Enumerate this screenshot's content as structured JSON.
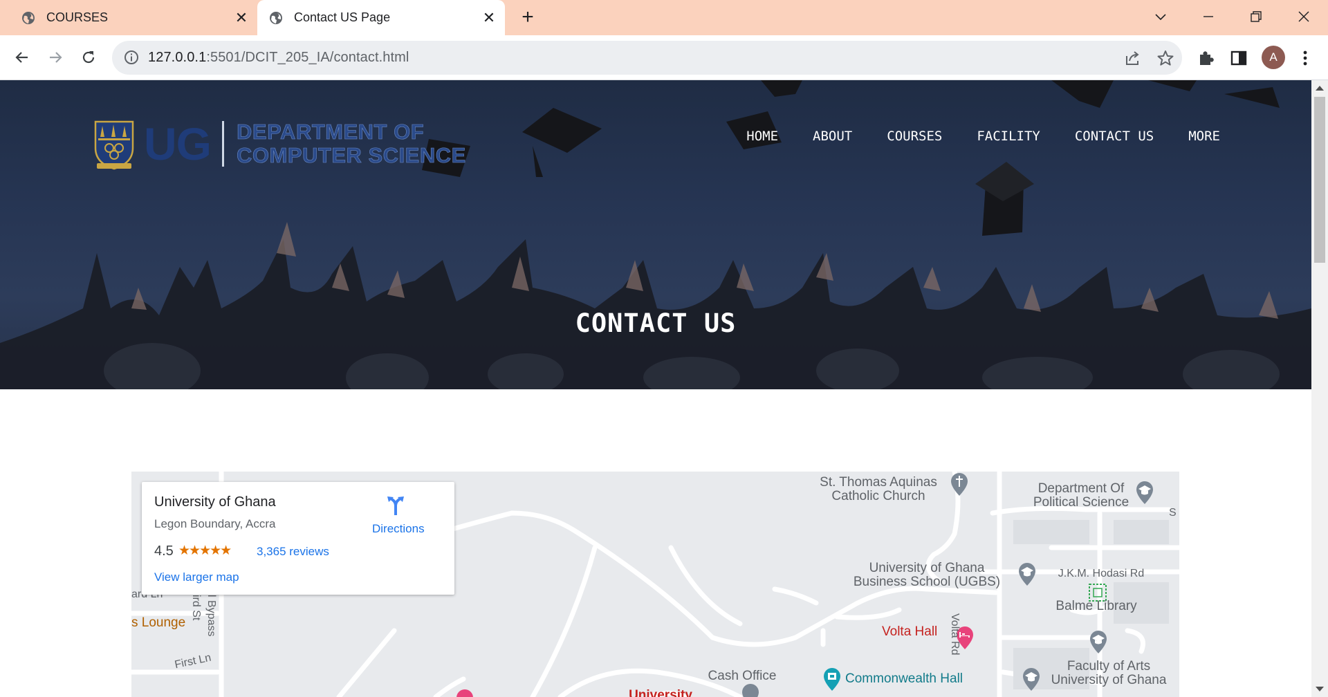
{
  "browser": {
    "tabs": [
      {
        "title": "COURSES",
        "active": false
      },
      {
        "title": "Contact US Page",
        "active": true
      }
    ],
    "url_host": "127.0.0.1",
    "url_rest": ":5501/DCIT_205_IA/contact.html",
    "profile_initial": "A"
  },
  "site": {
    "logo_text": "UG",
    "dept_line1": "DEPARTMENT OF",
    "dept_line2": "COMPUTER SCIENCE",
    "nav": [
      "HOME",
      "ABOUT",
      "COURSES",
      "FACILITY",
      "CONTACT US",
      "MORE"
    ],
    "hero_title": "CONTACT US"
  },
  "map": {
    "card": {
      "name": "University of Ghana",
      "address": "Legon Boundary, Accra",
      "rating": "4.5",
      "stars": "★★★★★",
      "reviews": "3,365 reviews",
      "larger_map": "View larger map",
      "directions": "Directions"
    },
    "labels": {
      "church": "St. Thomas Aquinas\nCatholic Church",
      "polsci": "Department Of\nPolitical Science",
      "ugbs": "University of Ghana\nBusiness School (UGBS)",
      "hodasi": "J.K.M. Hodasi Rd",
      "balme": "Balme Library",
      "volta_hall": "Volta Hall",
      "volta_rd": "Volta Rd",
      "arts": "Faculty of Arts\nUniversity of Ghana",
      "cash": "Cash Office",
      "commonwealth": "Commonwealth Hall",
      "lounge": "s Lounge",
      "first_ln": "First Ln",
      "bypass": "l Bypass",
      "third_st": "ird St",
      "ard_ln": "ard Ln",
      "univ": "University",
      "s_letter": "S"
    }
  }
}
